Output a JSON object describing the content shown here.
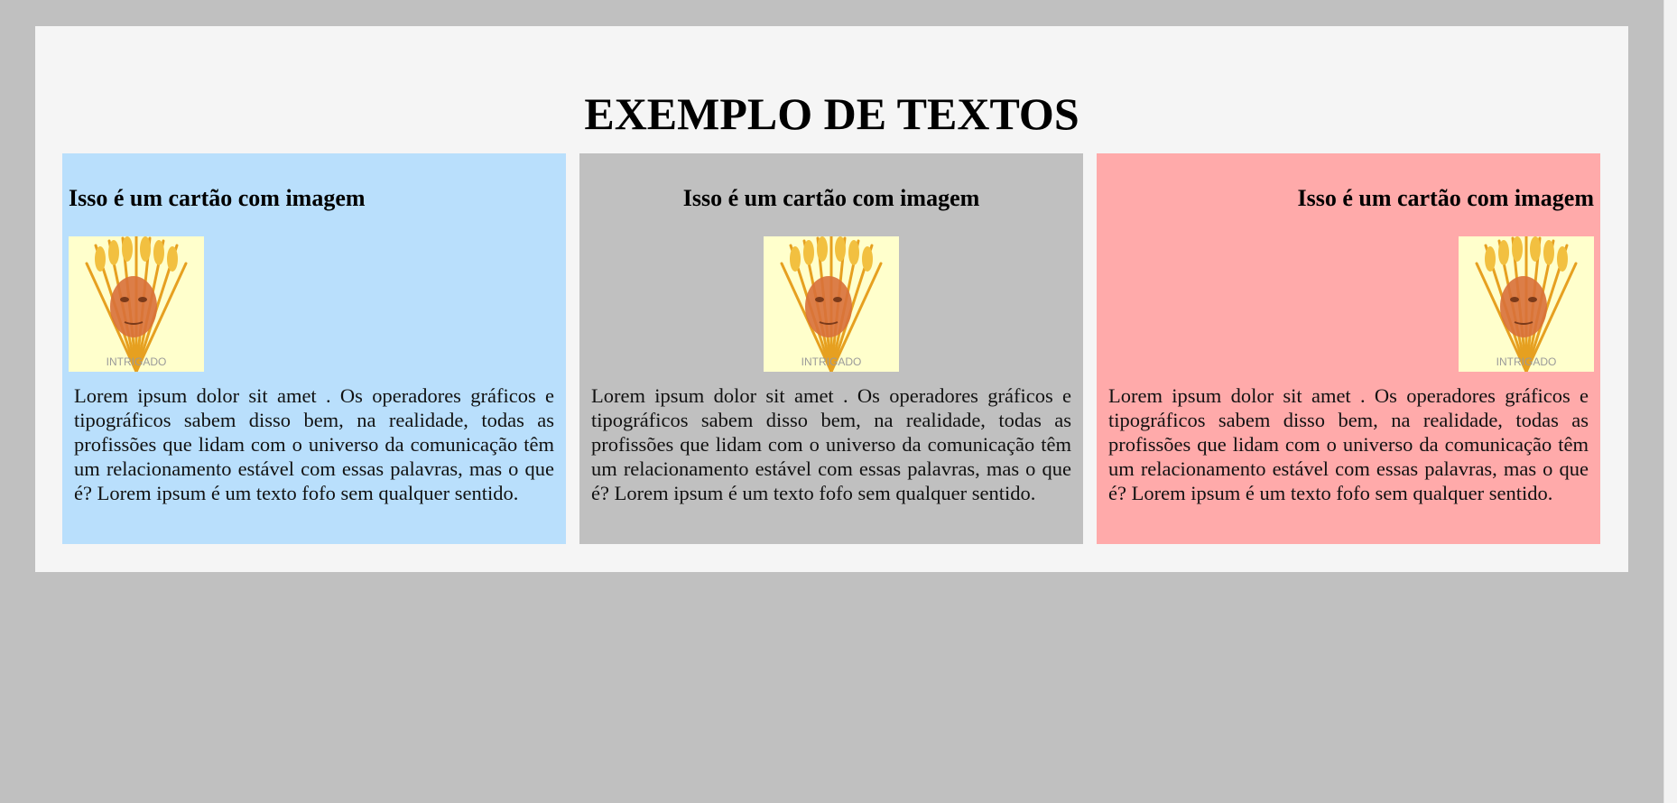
{
  "page": {
    "title": "EXEMPLO DE TEXTOS"
  },
  "cards": [
    {
      "title": "Isso é um cartão com imagem",
      "alignment": "left",
      "background": "#b9dffc",
      "image_caption": "INTRIGADO",
      "text": "Lorem ipsum dolor sit amet . Os operadores gráficos e tipográficos sabem disso bem, na realidade, todas as profissões que lidam com o universo da comunicação têm um relacionamento estável com essas palavras, mas o que é? Lorem ipsum é um texto fofo sem qualquer sentido."
    },
    {
      "title": "Isso é um cartão com imagem",
      "alignment": "center",
      "background": "#c0c0c0",
      "image_caption": "INTRIGADO",
      "text": "Lorem ipsum dolor sit amet . Os operadores gráficos e tipográficos sabem disso bem, na realidade, todas as profissões que lidam com o universo da comunicação têm um relacionamento estável com essas palavras, mas o que é? Lorem ipsum é um texto fofo sem qualquer sentido."
    },
    {
      "title": "Isso é um cartão com imagem",
      "alignment": "right",
      "background": "#ffaaaa",
      "image_caption": "INTRIGADO",
      "text": "Lorem ipsum dolor sit amet . Os operadores gráficos e tipográficos sabem disso bem, na realidade, todas as profissões que lidam com o universo da comunicação têm um relacionamento estável com essas palavras, mas o que é? Lorem ipsum é um texto fofo sem qualquer sentido."
    }
  ],
  "colors": {
    "page_background": "#c0c0c0",
    "panel_background": "#f5f5f5",
    "image_background": "#ffffcc",
    "wheat": "#f0b030",
    "face": "#d8703a"
  }
}
